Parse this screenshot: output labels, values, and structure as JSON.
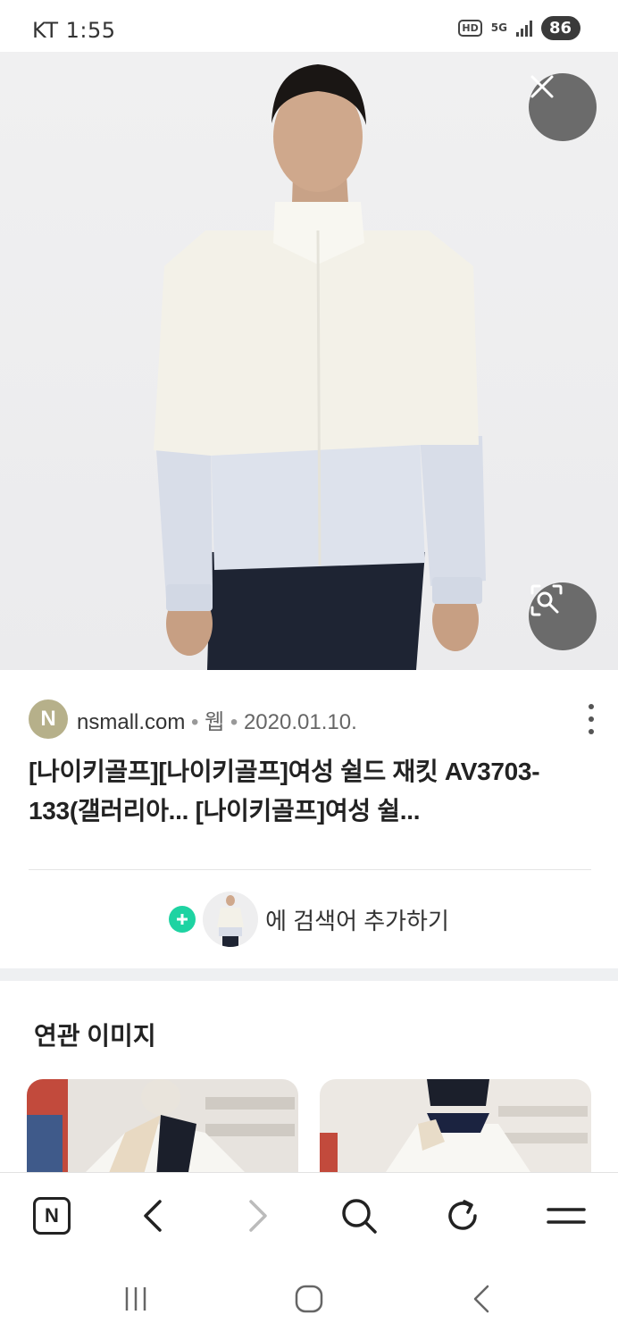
{
  "status_bar": {
    "time": "KT 1:55",
    "hd": "HD",
    "network": "5G",
    "battery": "86"
  },
  "hero": {
    "close_icon": "close-icon",
    "lens_icon": "image-search-icon"
  },
  "result": {
    "source_initial": "N",
    "source_name": "nsmall.com",
    "separator": "•",
    "source_type": "웹",
    "date": "2020.01.10.",
    "title": "[나이키골프][나이키골프]여성 쉴드 재킷 AV3703-133(갤러리아... [나이키골프]여성 쉴..."
  },
  "add_search": {
    "label": "에 검색어 추가하기"
  },
  "related": {
    "heading": "연관 이미지"
  },
  "bottom_nav": {
    "home_label": "N",
    "icons": [
      "naver-home-icon",
      "back-icon",
      "forward-icon",
      "search-icon",
      "refresh-icon",
      "menu-icon"
    ]
  },
  "colors": {
    "accent_green": "#1ed3a2",
    "avatar_bg": "#b6b08a",
    "overlay_button": "#6b6b6b"
  }
}
